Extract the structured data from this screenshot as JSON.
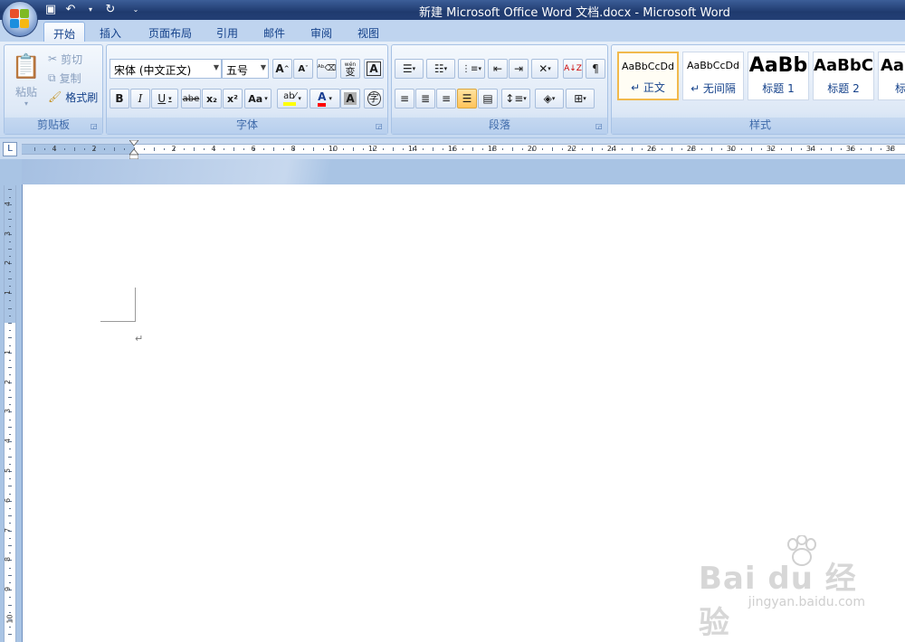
{
  "window": {
    "title": "新建 Microsoft Office Word 文档.docx - Microsoft Word"
  },
  "tabs": [
    {
      "label": "开始",
      "active": true
    },
    {
      "label": "插入"
    },
    {
      "label": "页面布局"
    },
    {
      "label": "引用"
    },
    {
      "label": "邮件"
    },
    {
      "label": "审阅"
    },
    {
      "label": "视图"
    }
  ],
  "clipboard": {
    "label": "剪贴板",
    "paste": "粘贴",
    "cut": "剪切",
    "copy": "复制",
    "format_painter": "格式刷"
  },
  "font": {
    "label": "字体",
    "family": "宋体 (中文正文)",
    "size": "五号",
    "phonetic": "wén",
    "phonetic_char": "变",
    "bold": "B",
    "italic": "I",
    "underline": "U",
    "strike": "abe",
    "subscript": "x₂",
    "superscript": "x²",
    "change_case": "Aa",
    "grow": "A",
    "shrink": "A",
    "border_char": "A",
    "shading_char": "A",
    "font_color": "A",
    "enclose": "字"
  },
  "paragraph": {
    "label": "段落"
  },
  "styles": {
    "label": "样式",
    "items": [
      {
        "sample": "AaBbCcDd",
        "name": "↵ 正文"
      },
      {
        "sample": "AaBbCcDd",
        "name": "↵ 无间隔"
      },
      {
        "sample": "AaBb",
        "name": "标题 1"
      },
      {
        "sample": "AaBbC",
        "name": "标题 2"
      },
      {
        "sample": "AaB",
        "name": "标"
      }
    ]
  },
  "ruler": {
    "tab_stop": "L",
    "horizontal_numbers": [
      "4",
      "2",
      "2",
      "4",
      "6",
      "8",
      "10",
      "12",
      "14",
      "16",
      "18",
      "20",
      "22",
      "24",
      "26",
      "28",
      "30",
      "32",
      "34",
      "36",
      "38"
    ],
    "vertical_numbers": [
      "4",
      "3",
      "2",
      "1",
      "1",
      "2",
      "3",
      "4",
      "5",
      "6",
      "7",
      "8",
      "9",
      "10"
    ]
  },
  "document": {
    "paragraph_mark": "↵"
  },
  "watermark": {
    "brand": "Bai du 经验",
    "url": "jingyan.baidu.com"
  },
  "colors": {
    "title_bar": "#1f3a6e",
    "ribbon_bg": "#d3e1f4",
    "accent_text": "#15428b",
    "style_selected_border": "#f1b94c",
    "highlight": "#ffff00",
    "font_color": "#ff0000"
  }
}
